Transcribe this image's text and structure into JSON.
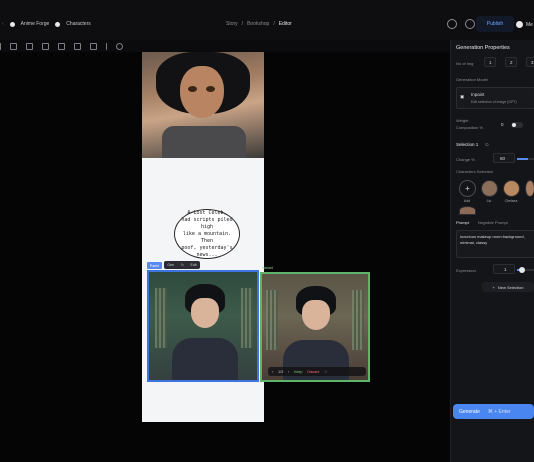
{
  "topbar": {
    "brand_left": "Anime Forge",
    "brand_right": "Characters",
    "breadcrumbs": [
      "Story",
      "Bookshop",
      "Editor"
    ],
    "publish_label": "Publish",
    "user_label": "Me"
  },
  "canvas": {
    "bubble_text": "A-Lost Celeb,\nhad scripts piled high\nlike a mountain. Then\npoof, yesterday's\nnews...",
    "selection_tag": "Panel",
    "mini_toolbar": [
      "Gen",
      "↻",
      "Edit"
    ],
    "edit_tag": "Variant",
    "variant_bar": {
      "count": "1/3",
      "keep": "Keep",
      "discard": "Discard"
    }
  },
  "properties": {
    "title": "Generation Properties",
    "no_of_img_label": "No of Img",
    "no_of_img_options": [
      "1",
      "2",
      "3"
    ],
    "model_label": "Generation Model",
    "model_name": "Inpaint",
    "model_sub": "Edit selection of image (GPT)",
    "weight_label": "Weight",
    "composition_label": "Composition %",
    "composition_value": "0",
    "selection_title": "Selection 1",
    "change_label": "Change %",
    "change_value": "60",
    "characters_label": "Characters Selection",
    "characters": [
      {
        "name": "Add"
      },
      {
        "name": "Liu"
      },
      {
        "name": "Chelsea"
      },
      {
        "name": "Mia"
      }
    ],
    "tab_prompt": "Prompt",
    "tab_negative": "Negative Prompt",
    "prompt_value": "luxurious makeup room background, minimal, classy",
    "expression_label": "Expression",
    "expression_value": "1",
    "new_selection_label": "New Selection",
    "generate_label": "Generate",
    "generate_kbd": "⌘ + Enter"
  }
}
